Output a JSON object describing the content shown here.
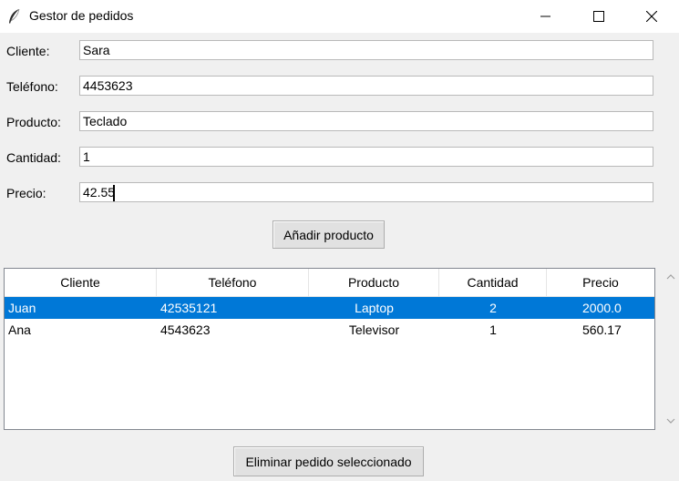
{
  "window": {
    "title": "Gestor de pedidos",
    "icon": "feather-icon",
    "controls": [
      "minimize-icon",
      "maximize-icon",
      "close-icon"
    ]
  },
  "form": {
    "cliente": {
      "label": "Cliente:",
      "value": "Sara"
    },
    "telefono": {
      "label": "Teléfono:",
      "value": "4453623"
    },
    "producto": {
      "label": "Producto:",
      "value": "Teclado"
    },
    "cantidad": {
      "label": "Cantidad:",
      "value": "1"
    },
    "precio": {
      "label": "Precio:",
      "value": "42.55"
    }
  },
  "buttons": {
    "add": "Añadir producto",
    "remove": "Eliminar pedido seleccionado"
  },
  "table": {
    "columns": [
      "Cliente",
      "Teléfono",
      "Producto",
      "Cantidad",
      "Precio"
    ],
    "rows": [
      {
        "cliente": "Juan",
        "telefono": "42535121",
        "producto": "Laptop",
        "cantidad": "2",
        "precio": "2000.0",
        "selected": true
      },
      {
        "cliente": "Ana",
        "telefono": "4543623",
        "producto": "Televisor",
        "cantidad": "1",
        "precio": "560.17",
        "selected": false
      }
    ]
  },
  "colors": {
    "selection": "#0078d7",
    "window_bg": "#f0f0f0"
  }
}
